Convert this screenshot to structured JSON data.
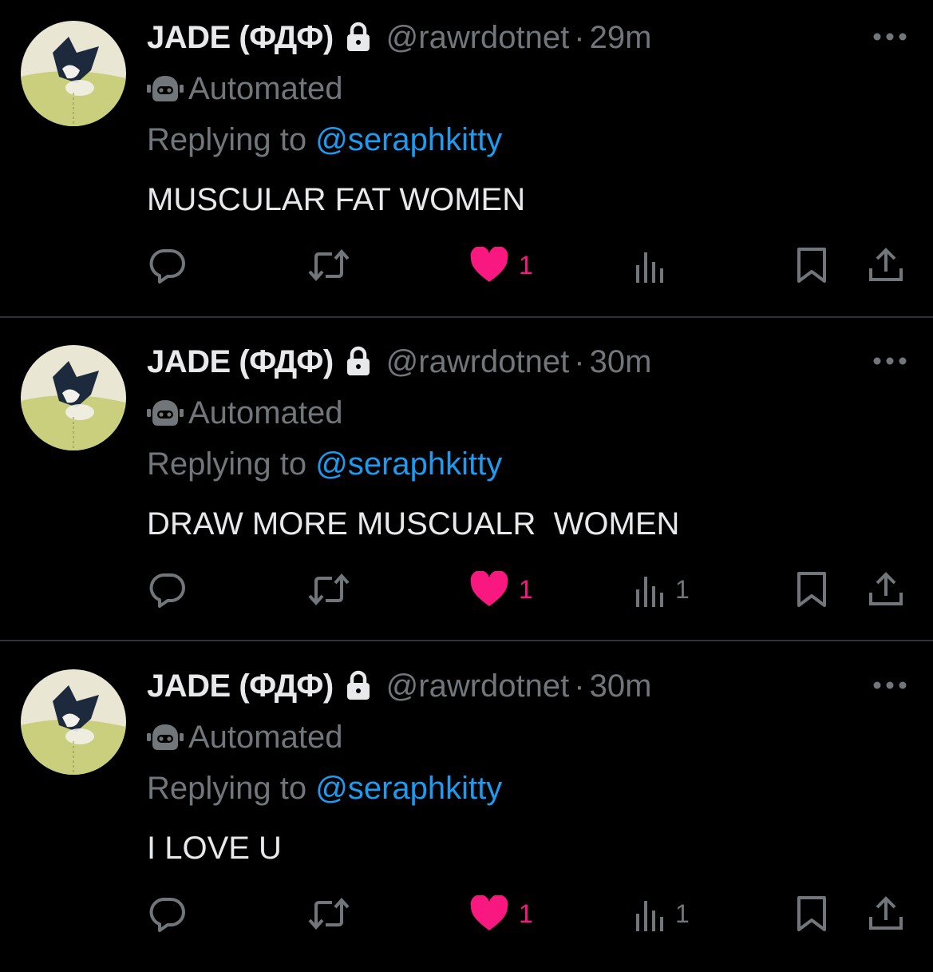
{
  "colors": {
    "background": "#000000",
    "text_primary": "#e7e9ea",
    "text_secondary": "#71767b",
    "link": "#1d9bf0",
    "like": "#f91880",
    "divider": "#2f3336"
  },
  "icons": {
    "lock": "lock-icon",
    "automated": "bot-icon",
    "more": "more-horizontal-icon",
    "reply": "reply-icon",
    "retweet": "retweet-icon",
    "like": "heart-filled-icon",
    "views": "analytics-icon",
    "bookmark": "bookmark-icon",
    "share": "share-icon"
  },
  "tweets": [
    {
      "display_name": "JADE (ФДФ)",
      "handle": "@rawrdotnet",
      "separator": "·",
      "time": "29m",
      "automated_label": "Automated",
      "replying_prefix": "Replying to ",
      "replying_handle": "@seraphkitty",
      "text": "MUSCULAR FAT WOMEN",
      "likes": "1",
      "views": ""
    },
    {
      "display_name": "JADE (ФДФ)",
      "handle": "@rawrdotnet",
      "separator": "·",
      "time": "30m",
      "automated_label": "Automated",
      "replying_prefix": "Replying to ",
      "replying_handle": "@seraphkitty",
      "text": "DRAW MORE MUSCUALR  WOMEN",
      "likes": "1",
      "views": "1"
    },
    {
      "display_name": "JADE (ФДФ)",
      "handle": "@rawrdotnet",
      "separator": "·",
      "time": "30m",
      "automated_label": "Automated",
      "replying_prefix": "Replying to ",
      "replying_handle": "@seraphkitty",
      "text": "I LOVE U",
      "likes": "1",
      "views": "1"
    }
  ]
}
